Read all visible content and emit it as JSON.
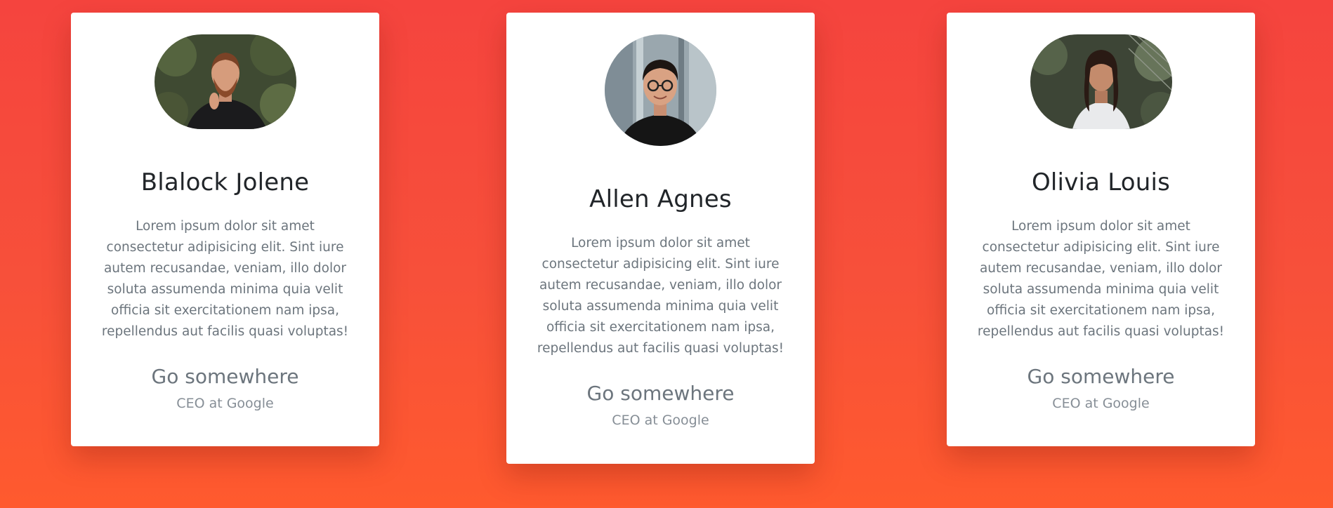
{
  "cards": [
    {
      "name": "Blalock Jolene",
      "bio": "Lorem ipsum dolor sit amet consectetur adipisicing elit. Sint iure autem recusandae, veniam, illo dolor soluta assumenda minima quia velit officia sit exercitationem nam ipsa, repellendus aut facilis quasi voluptas!",
      "link": "Go somewhere",
      "role": "CEO at Google"
    },
    {
      "name": "Allen Agnes",
      "bio": "Lorem ipsum dolor sit amet consectetur adipisicing elit. Sint iure autem recusandae, veniam, illo dolor soluta assumenda minima quia velit officia sit exercitationem nam ipsa, repellendus aut facilis quasi voluptas!",
      "link": "Go somewhere",
      "role": "CEO at Google"
    },
    {
      "name": "Olivia Louis",
      "bio": "Lorem ipsum dolor sit amet consectetur adipisicing elit. Sint iure autem recusandae, veniam, illo dolor soluta assumenda minima quia velit officia sit exercitationem nam ipsa, repellendus aut facilis quasi voluptas!",
      "link": "Go somewhere",
      "role": "CEO at Google"
    }
  ],
  "colors": {
    "background_top": "#f5443e",
    "background_bottom": "#ff5a2e",
    "card": "#ffffff",
    "name_text": "#212529",
    "muted_text": "#6c757d"
  }
}
